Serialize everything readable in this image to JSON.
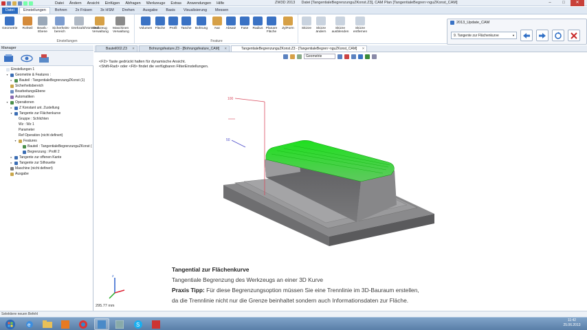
{
  "window": {
    "app_title": "ZW3D 2013",
    "file_title": "Datei [TangentialeBegrenzunguZKonst.Z3], CAM Plan [TangentialeBegren~nguZKonst_CAM]"
  },
  "menu": [
    "Datei",
    "Ändern",
    "Ansicht",
    "Einfügen",
    "Abfragen",
    "Werkzeuge",
    "Extras",
    "Anwendungen",
    "Hilfe"
  ],
  "ribbon_tabs": [
    "Datei",
    "Einstellungen",
    "Bohren",
    "2x Fräsen",
    "3x HSM",
    "Drehen",
    "Ausgabe",
    "Basis",
    "Visualisierung",
    "Messen"
  ],
  "ribbon_active_tab": "Einstellungen",
  "ribbon_groups": {
    "einstellungen": {
      "label": "Einstellungen",
      "buttons": [
        "Geometrie",
        "Rohteil",
        "Bearb.-Ebene",
        "Sicherheits-bereich",
        "Drehzahl/Vorschub",
        "Werkzeug Verwaltung",
        "Maschinen Verwaltung"
      ]
    },
    "feature": {
      "label": "Feature",
      "buttons": [
        "Volumen",
        "Fläche",
        "Profil",
        "Tasche",
        "Bohrung",
        "Nut",
        "Absatz",
        "Fase",
        "Radius",
        "Planare Fläche",
        "ZylForm"
      ]
    },
    "skizze": {
      "label": "",
      "buttons": [
        "Skizze",
        "Skizze ändern",
        "Skizze ausblenden",
        "Skizze entfernen"
      ]
    }
  },
  "cam_panel": {
    "title": "2013_Update_CAM",
    "selected": "9. Tangente zur Flächenkurve"
  },
  "manager": {
    "title": "Manager",
    "tree": [
      {
        "label": "Einstellungen 1",
        "indent": 0,
        "arrow": "",
        "icon": "#dfe6ef"
      },
      {
        "label": "Geometrie & Features :",
        "indent": 1,
        "arrow": "▾",
        "icon": "#3b6db3"
      },
      {
        "label": "Bauteil : TangentialeBegrenzungZKonst (1)",
        "indent": 2,
        "arrow": "▸",
        "icon": "#4b8f4b"
      },
      {
        "label": "Sicherheitsbereich",
        "indent": 1,
        "arrow": "",
        "icon": "#c9a64a"
      },
      {
        "label": "BearbeitungsEbene",
        "indent": 1,
        "arrow": "",
        "icon": "#6a8cc0"
      },
      {
        "label": "Automatiken",
        "indent": 1,
        "arrow": "",
        "icon": "#8a6ab0"
      },
      {
        "label": "Operationen",
        "indent": 1,
        "arrow": "▾",
        "icon": "#4b8f4b"
      },
      {
        "label": "Z Konstant unt. Zustellung",
        "indent": 2,
        "arrow": "▸",
        "icon": "#3b6db3"
      },
      {
        "label": "Tangente zur Flächenkurve",
        "indent": 2,
        "arrow": "▾",
        "icon": "#3b6db3"
      },
      {
        "label": "Gruppe : Schlichten",
        "indent": 3,
        "arrow": "",
        "icon": ""
      },
      {
        "label": "Wz : Wz 1",
        "indent": 3,
        "arrow": "",
        "icon": ""
      },
      {
        "label": "Parameter",
        "indent": 3,
        "arrow": "",
        "icon": ""
      },
      {
        "label": "Ref Operation (nicht definert)",
        "indent": 3,
        "arrow": "",
        "icon": ""
      },
      {
        "label": "Features",
        "indent": 3,
        "arrow": "▾",
        "icon": "#c9a64a"
      },
      {
        "label": "Bauteil : TangentialeBegrenzunguZKonst (",
        "indent": 4,
        "arrow": "",
        "icon": "#4b8f4b"
      },
      {
        "label": "Begrenzung : Profil 2",
        "indent": 4,
        "arrow": "",
        "icon": "#3b6db3"
      },
      {
        "label": "Tangente zur offenen Kante",
        "indent": 2,
        "arrow": "▸",
        "icon": "#3b6db3"
      },
      {
        "label": "Tangente zur Silhouette",
        "indent": 2,
        "arrow": "▸",
        "icon": "#3b6db3"
      },
      {
        "label": "Maschine (nicht definert)",
        "indent": 1,
        "arrow": "",
        "icon": "#7a7a7a"
      },
      {
        "label": "Ausgabe",
        "indent": 1,
        "arrow": "",
        "icon": "#c9a64a"
      }
    ]
  },
  "doc_tabs": [
    "Bauteil002.Z3",
    "Bohrungsfeature.Z3 - [Bohrungsfeature_CAM]",
    "TangentialeBegrenzunguZKonst.Z3 - [TangentialeBegren~nguZKonst_CAM]"
  ],
  "doc_tab_active": 2,
  "viewport": {
    "filter_select": "Geometrie",
    "hint_line1": "<F2> Taste gedrückt halten für dynamische Ansicht.",
    "hint_line2": "<Shift-Rad> oder <F8> findet die verfügbaren FilterEinstellungen.",
    "axis_label_1": "100",
    "axis_label_2": "50",
    "distance": "295.77 mm",
    "caption": {
      "title": "Tangential zur Flächenkurve",
      "subtitle": "Tangentiale Begrenzung des Werkzeugs an einer 3D Kurve",
      "tip_label": "Praxis Tipp:",
      "tip_text": " Für diese Begrenzungsoption müssen Sie eine Trennlinie im 3D-Bauraum erstellen,",
      "tip_line2": "da die Trennlinie nicht nur die Grenze beinhaltet sondern auch Informationsdaten zur  Fläche."
    }
  },
  "status": "Selektiere neuen Befehl",
  "taskbar": {
    "time": "11:42",
    "date": "25.06.2013"
  },
  "colors": {
    "accent": "#2b6cc2",
    "toolpath_green": "#22dd22",
    "part_gray": "#6e6e70"
  }
}
